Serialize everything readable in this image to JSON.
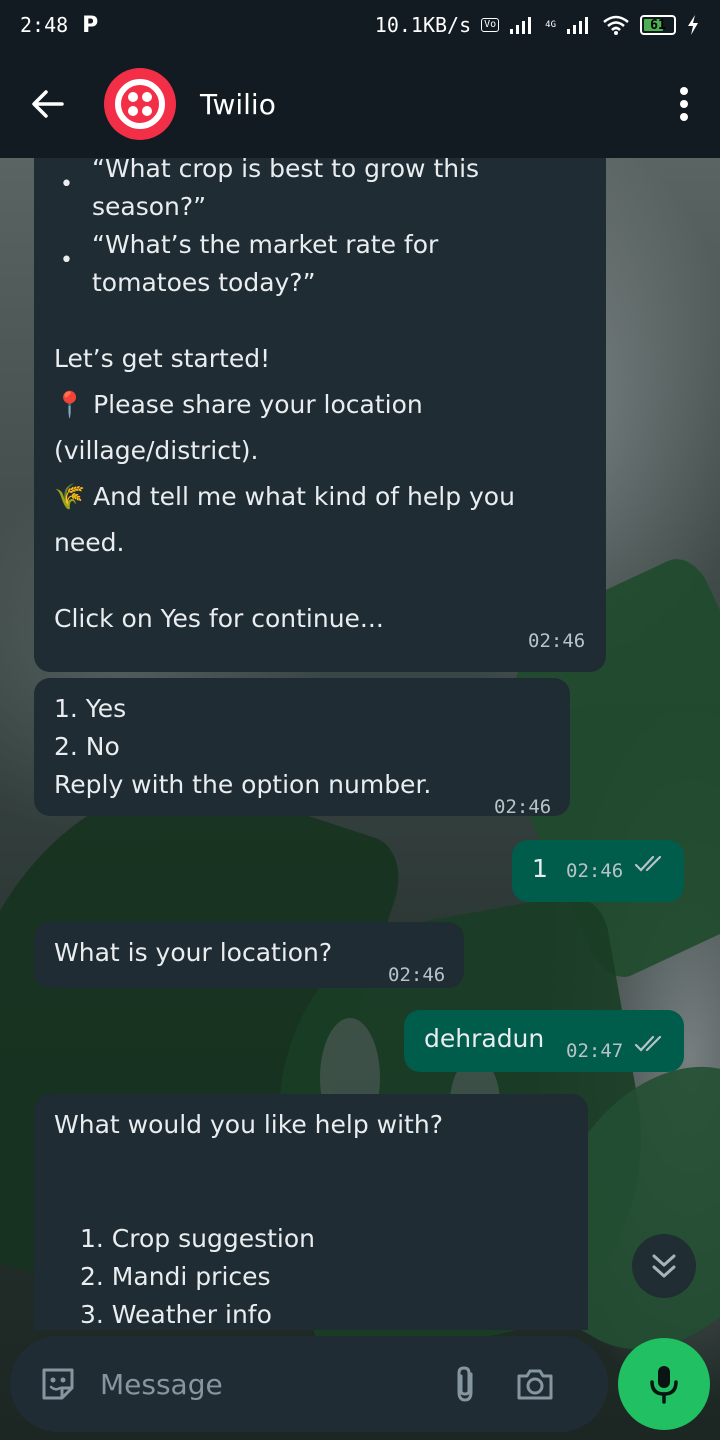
{
  "status_bar": {
    "time": "2:48",
    "network_speed": "10.1KB/s",
    "battery": "61",
    "network_label": "4G"
  },
  "header": {
    "title": "Twilio",
    "back_icon": "arrow-left-icon",
    "menu_icon": "more-vert-icon"
  },
  "messages": [
    {
      "direction": "incoming",
      "bullets": [
        "“What crop is best to grow this",
        "season?”",
        "“What’s the market rate for",
        "tomatoes today?”"
      ],
      "lines": [
        "Let’s get started!",
        "📍 Please share your location",
        "(village/district).",
        "🌾 And tell me what kind of help you",
        "need.",
        "Click on Yes for continue..."
      ],
      "time": "02:46"
    },
    {
      "direction": "incoming",
      "lines": [
        "1. Yes",
        "2. No",
        "Reply with the option number."
      ],
      "time": "02:46"
    },
    {
      "direction": "outgoing",
      "text": "1",
      "time": "02:46",
      "status_icon": "double-check-icon"
    },
    {
      "direction": "incoming",
      "text": "What is your location?",
      "time": "02:46"
    },
    {
      "direction": "outgoing",
      "text": "dehradun",
      "time": "02:47",
      "status_icon": "double-check-icon"
    },
    {
      "direction": "incoming",
      "lines": [
        "What would you like help with?",
        "1. Crop suggestion",
        "2. Mandi prices",
        "3. Weather info"
      ]
    }
  ],
  "input": {
    "placeholder": "Message"
  },
  "colors": {
    "app_bar": "#111b21",
    "incoming_bubble": "#202c33",
    "outgoing_bubble": "#005c4b",
    "mic_button": "#21c063",
    "twilio_red": "#f22f46"
  }
}
